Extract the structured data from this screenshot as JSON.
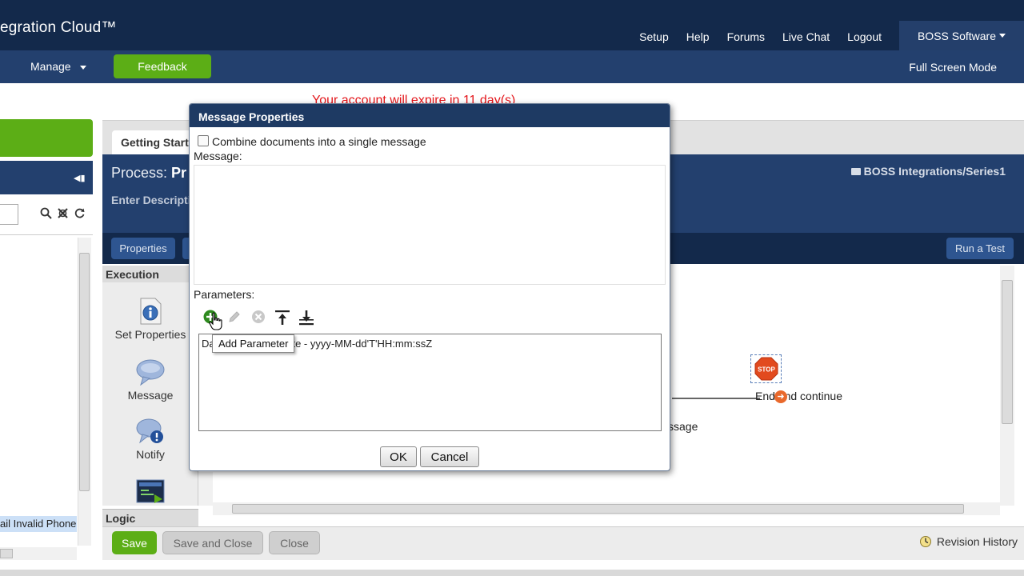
{
  "header": {
    "app_title": "egration Cloud™",
    "links": [
      "Setup",
      "Help",
      "Forums",
      "Live Chat",
      "Logout"
    ],
    "account": "BOSS Software"
  },
  "nav": {
    "manage": "Manage",
    "feedback": "Feedback",
    "fullscreen": "Full Screen Mode"
  },
  "notice": "Your account will expire in 11 day(s)",
  "left_panel": {
    "selected_item": "ail Invalid Phone"
  },
  "process": {
    "tab_label": "Getting Start",
    "title_prefix": "Process: ",
    "title_name": "Pr",
    "description": "Enter Descripti",
    "path": "BOSS Integrations/Series1",
    "properties_button": "Properties",
    "run_test_button": "Run a Test"
  },
  "palette": {
    "execution_header": "Execution",
    "items": [
      {
        "label": "Set Properties",
        "icon": "info-icon"
      },
      {
        "label": "Message",
        "icon": "speech-bubble-icon"
      },
      {
        "label": "Notify",
        "icon": "notify-icon"
      },
      {
        "label": "",
        "icon": "terminal-icon"
      }
    ],
    "logic_header": "Logic"
  },
  "canvas": {
    "end_shape_label": "End and continue",
    "stop_text": "STOP",
    "message_shape_label": "ssage"
  },
  "bottom": {
    "save": "Save",
    "save_close": "Save and Close",
    "close": "Close",
    "revision_history": "Revision History"
  },
  "dialog": {
    "title": "Message Properties",
    "combine_label": "Combine documents into a single message",
    "combine_checked": false,
    "message_label": "Message:",
    "message_value": "",
    "parameters_label": "Parameters:",
    "parameter_rows": [
      "Da",
      "t Date - yyyy-MM-dd'T'HH:mm:ssZ"
    ],
    "tooltip": "Add Parameter",
    "ok": "OK",
    "cancel": "Cancel"
  },
  "colors": {
    "header_dark": "#13294b",
    "nav_blue": "#23406e",
    "green_accent": "#5cae16",
    "warning_red": "#e4161b"
  }
}
